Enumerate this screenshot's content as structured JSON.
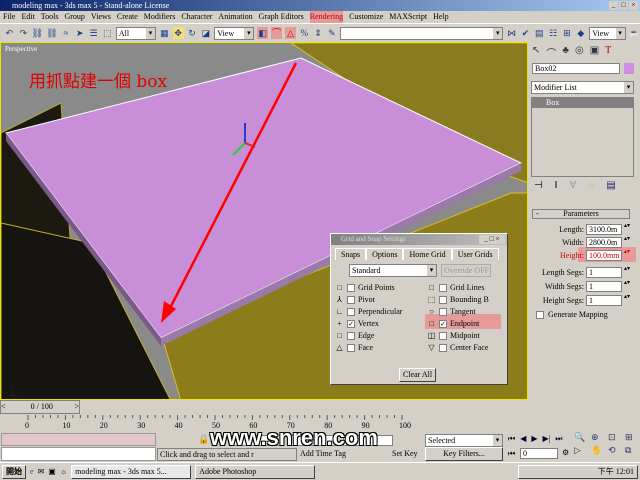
{
  "window": {
    "title": "modeling max - 3ds max 5 - Stand-alone License",
    "controls": [
      "_",
      "□",
      "×"
    ]
  },
  "menu": [
    "File",
    "Edit",
    "Tools",
    "Group",
    "Views",
    "Create",
    "Modifiers",
    "Character",
    "Animation",
    "Graph Editors",
    "Rendering",
    "Customize",
    "MAXScript",
    "Help"
  ],
  "toolbar": {
    "selection_filter": "All",
    "ref_coord": "View",
    "named_selection": "",
    "view2": "View"
  },
  "viewport": {
    "label": "Perspective",
    "annotation": "用抓點建一個 box",
    "plane_color": "#c88ed8"
  },
  "command_panel": {
    "object_name": "Box02",
    "object_color": "#d08ee0",
    "modifier_list": "Modifier List",
    "stack_item": "Box",
    "rollout": "Parameters",
    "params": [
      {
        "label": "Length:",
        "value": "3100.0m"
      },
      {
        "label": "Width:",
        "value": "2800.0m"
      },
      {
        "label": "Height:",
        "value": "100.0mm"
      }
    ],
    "segs": [
      {
        "label": "Length Segs:",
        "value": "1"
      },
      {
        "label": "Width Segs:",
        "value": "1"
      },
      {
        "label": "Height Segs:",
        "value": "1"
      }
    ],
    "generate_mapping": "Generate Mapping"
  },
  "snap_dialog": {
    "title": "Grid and Snap Settings",
    "tabs": [
      "Snaps",
      "Options",
      "Home Grid",
      "User Grids"
    ],
    "preset": "Standard",
    "override": "Override OFF",
    "left": [
      {
        "label": "Grid Points",
        "sym": "□",
        "checked": ""
      },
      {
        "label": "Pivot",
        "sym": "⅄",
        "checked": ""
      },
      {
        "label": "Perpendicular",
        "sym": "∟",
        "checked": ""
      },
      {
        "label": "Vertex",
        "sym": "+",
        "checked": "✓"
      },
      {
        "label": "Edge",
        "sym": "□",
        "checked": ""
      },
      {
        "label": "Face",
        "sym": "△",
        "checked": ""
      }
    ],
    "right": [
      {
        "label": "Grid Lines",
        "sym": "□",
        "checked": ""
      },
      {
        "label": "Bounding B",
        "sym": "⬚",
        "checked": ""
      },
      {
        "label": "Tangent",
        "sym": "○",
        "checked": ""
      },
      {
        "label": "Endpoint",
        "sym": "□",
        "checked": "✓"
      },
      {
        "label": "Midpoint",
        "sym": "◫",
        "checked": ""
      },
      {
        "label": "Center Face",
        "sym": "▽",
        "checked": ""
      }
    ],
    "clear_all": "Clear All"
  },
  "timeline": {
    "frame": "0 / 100",
    "ticks": [
      "0",
      "10",
      "20",
      "30",
      "40",
      "50",
      "60",
      "70",
      "80",
      "90",
      "100"
    ]
  },
  "status": {
    "prompt": "Click and drag to select and r",
    "add_time_tag": "Add Time Tag",
    "set_key": "Set Key",
    "key_mode": "Selected",
    "key_filters": "Key Filters...",
    "frame_field": "0",
    "watermark": "www.snren.com"
  },
  "taskbar": {
    "start": "開始",
    "tasks": [
      "modeling max - 3ds max 5...",
      "Adobe Photoshop"
    ],
    "clock": "下午 12:01"
  }
}
